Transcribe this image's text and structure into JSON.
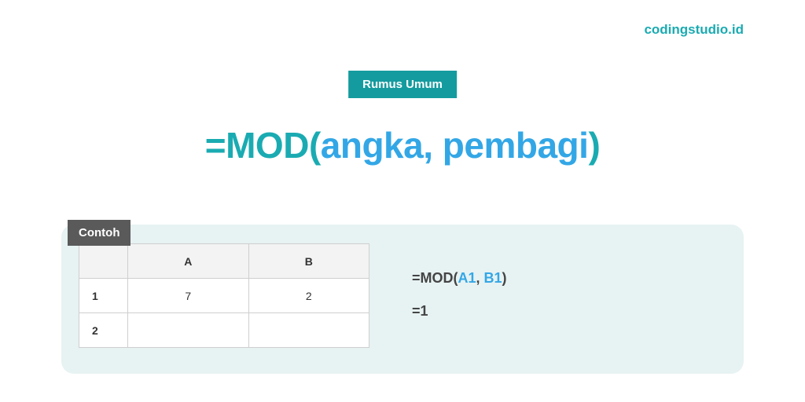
{
  "brand": "codingstudio.id",
  "badge": "Rumus Umum",
  "formula": {
    "eq": "=",
    "fn": "MOD",
    "open": "(",
    "arg1": "angka",
    "comma": ", ",
    "arg2": "pembagi",
    "close": ")"
  },
  "example": {
    "label": "Contoh",
    "headers": {
      "colA": "A",
      "colB": "B"
    },
    "rows": [
      {
        "num": "1",
        "a": "7",
        "b": "2"
      },
      {
        "num": "2",
        "a": "",
        "b": ""
      }
    ],
    "formula_parts": {
      "prefix": "=MOD(",
      "ref1": "A1",
      "sep": ", ",
      "ref2": "B1",
      "suffix": ")"
    },
    "result": "=1"
  }
}
